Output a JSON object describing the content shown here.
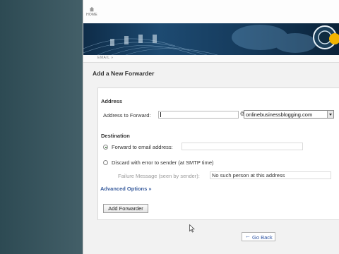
{
  "header": {
    "home_label": "HOME",
    "crumb": "EMAIL »"
  },
  "page_title": "Add a New Forwarder",
  "address": {
    "section_label": "Address",
    "forward_label": "Address to Forward:",
    "forward_value": "",
    "at_sign": "@",
    "domain_selected": "onlinebusinessblogging.com"
  },
  "destination": {
    "section_label": "Destination",
    "forward_option": "Forward to email address:",
    "forward_email_value": "",
    "discard_option": "Discard with error to sender (at SMTP time)",
    "failure_label": "Failure Message (seen by sender):",
    "failure_value": "No such person at this address"
  },
  "advanced_options": "Advanced Options »",
  "add_button": "Add Forwarder",
  "go_back": "Go Back",
  "icons": [
    "home-icon",
    "radio-checked-icon",
    "radio-unchecked-icon",
    "chevron-down-icon",
    "back-arrow-icon",
    "mouse-cursor-icon"
  ]
}
